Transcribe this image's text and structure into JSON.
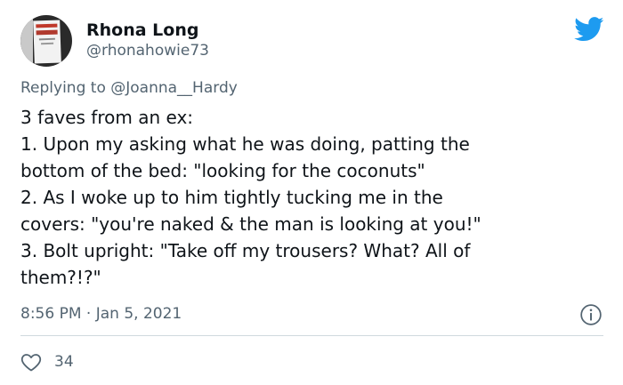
{
  "author": {
    "name": "Rhona Long",
    "handle": "@rhonahowie73"
  },
  "reply": {
    "prefix": "Replying to",
    "mention": "@Joanna__Hardy"
  },
  "tweet": {
    "lines": [
      "3 faves from an ex:",
      "1. Upon my asking what he was doing, patting the",
      "bottom of the bed: \"looking for the coconuts\"",
      "2. As I woke up to him tightly tucking me in the",
      "covers: \"you're naked & the man is looking at you!\"",
      "3. Bolt upright: \"Take off my trousers? What? All of",
      "them?!?\""
    ]
  },
  "meta": {
    "timestamp": "8:56 PM · Jan 5, 2021"
  },
  "stats": {
    "likes": "34"
  },
  "icons": {
    "brand": "twitter-bird-icon",
    "info": "info-icon",
    "like": "heart-icon"
  },
  "colors": {
    "brand": "#1d9bf0",
    "secondary_text": "#536471",
    "primary_text": "#0f1419",
    "divider": "#cfd9de"
  }
}
